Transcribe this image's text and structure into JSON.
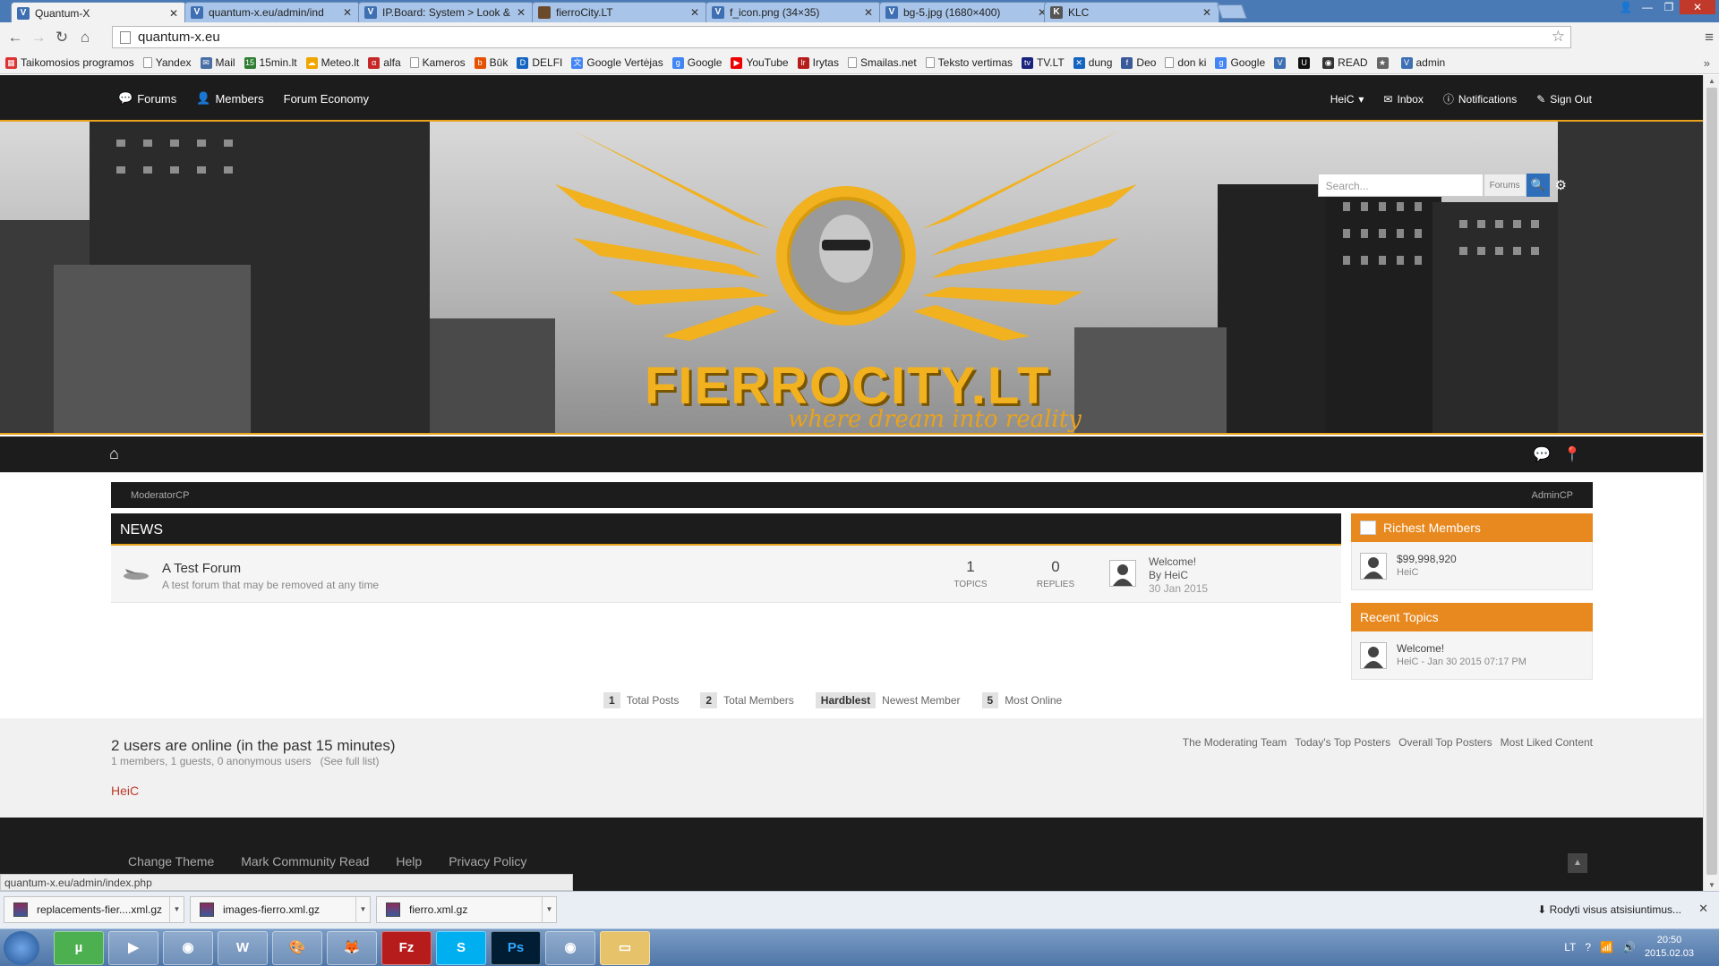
{
  "browser": {
    "tabs": [
      {
        "title": "Quantum-X",
        "active": true
      },
      {
        "title": "quantum-x.eu/admin/ind"
      },
      {
        "title": "IP.Board: System > Look &"
      },
      {
        "title": "fierroCity.LT"
      },
      {
        "title": "f_icon.png (34×35)"
      },
      {
        "title": "bg-5.jpg (1680×400)"
      },
      {
        "title": "KLC"
      }
    ],
    "url": "quantum-x.eu",
    "bookmarks": [
      {
        "label": "Taikomosios programos",
        "icon": "apps-grid-icon"
      },
      {
        "label": "Yandex",
        "icon": "page-icon"
      },
      {
        "label": "Mail",
        "icon": "mail-icon"
      },
      {
        "label": "15min.lt",
        "icon": "15min-icon"
      },
      {
        "label": "Meteo.lt",
        "icon": "weather-icon"
      },
      {
        "label": "alfa",
        "icon": "alfa-icon"
      },
      {
        "label": "Kameros",
        "icon": "page-icon"
      },
      {
        "label": "Būk",
        "icon": "buk-icon"
      },
      {
        "label": "DELFI",
        "icon": "delfi-icon"
      },
      {
        "label": "Google Vertėjas",
        "icon": "translate-icon"
      },
      {
        "label": "Google",
        "icon": "google-icon"
      },
      {
        "label": "YouTube",
        "icon": "youtube-icon"
      },
      {
        "label": "Irytas",
        "icon": "lrytas-icon"
      },
      {
        "label": "Smailas.net",
        "icon": "page-icon"
      },
      {
        "label": "Teksto vertimas",
        "icon": "page-icon"
      },
      {
        "label": "TV.LT",
        "icon": "tv-icon"
      },
      {
        "label": "dung",
        "icon": "dung-icon"
      },
      {
        "label": "Deo",
        "icon": "facebook-icon"
      },
      {
        "label": "don ki",
        "icon": "page-icon"
      },
      {
        "label": "Google",
        "icon": "google-icon"
      },
      {
        "label": "",
        "icon": "quantum-icon"
      },
      {
        "label": "",
        "icon": "u-icon"
      },
      {
        "label": "READ",
        "icon": "read-icon"
      },
      {
        "label": "",
        "icon": "misc-icon"
      },
      {
        "label": "admin",
        "icon": "quantum-icon"
      }
    ]
  },
  "forum": {
    "nav": {
      "forums": "Forums",
      "members": "Members",
      "economy": "Forum Economy"
    },
    "user": {
      "name": "HeiC",
      "inbox": "Inbox",
      "notifications": "Notifications",
      "signout": "Sign Out"
    },
    "search": {
      "placeholder": "Search...",
      "scope": "Forums"
    },
    "banner": {
      "logo_text": "FIERROCITY.LT",
      "slogan": "where dream into reality"
    },
    "modbar": {
      "left": "ModeratorCP",
      "right": "AdminCP"
    },
    "category": {
      "title": "NEWS"
    },
    "forum_row": {
      "name": "A Test Forum",
      "description": "A test forum that may be removed at any time",
      "topics": "1",
      "topics_label": "TOPICS",
      "replies": "0",
      "replies_label": "REPLIES",
      "last_title": "Welcome!",
      "last_by": "By HeiC",
      "last_date": "30 Jan 2015"
    },
    "richest": {
      "title": "Richest Members",
      "amount": "$99,998,920",
      "member": "HeiC"
    },
    "recent": {
      "title": "Recent Topics",
      "topic": "Welcome!",
      "meta": "HeiC - Jan 30 2015 07:17 PM"
    },
    "stats": {
      "total_posts": "1",
      "total_posts_label": "Total Posts",
      "total_members": "2",
      "total_members_label": "Total Members",
      "newest": "Hardblest",
      "newest_label": "Newest Member",
      "most_online": "5",
      "most_online_label": "Most Online"
    },
    "online": {
      "heading": "2 users are online (in the past 15 minutes)",
      "breakdown": "1 members, 1 guests, 0 anonymous users",
      "full_list": "(See full list)",
      "user": "HeiC",
      "links": [
        "The Moderating Team",
        "Today's Top Posters",
        "Overall Top Posters",
        "Most Liked Content"
      ]
    },
    "footer": {
      "links": [
        "Change Theme",
        "Mark Community Read",
        "Help",
        "Privacy Policy"
      ]
    }
  },
  "status_url": "quantum-x.eu/admin/index.php",
  "downloads": {
    "items": [
      "replacements-fier....xml.gz",
      "images-fierro.xml.gz",
      "fierro.xml.gz"
    ],
    "show_all": "Rodyti visus atsisiuntimus..."
  },
  "taskbar": {
    "apps": [
      "utorrent",
      "media-player",
      "chrome",
      "word",
      "paint",
      "firefox",
      "filezilla",
      "skype",
      "photoshop",
      "chrome",
      "explorer"
    ],
    "ps_label": "Ps",
    "lang": "LT",
    "time": "20:50",
    "date": "2015.02.03"
  },
  "colors": {
    "accent": "#e8a21d",
    "side_head": "#e8891f",
    "dark": "#1c1c1c",
    "online_user": "#c0392b",
    "search_btn": "#2f6fba"
  }
}
